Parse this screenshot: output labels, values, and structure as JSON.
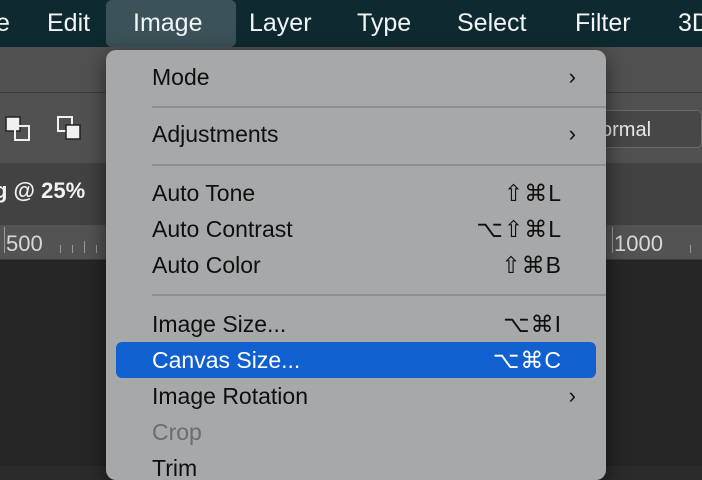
{
  "menubar": {
    "items": [
      "e",
      "Edit",
      "Image",
      "Layer",
      "Type",
      "Select",
      "Filter",
      "3D"
    ],
    "active": "Image"
  },
  "optionsbar": {
    "blend_mode": "ormal"
  },
  "document_tab": {
    "title": "g @ 25%"
  },
  "ruler": {
    "labels": [
      "500",
      "1000"
    ]
  },
  "image_menu": {
    "mode": {
      "label": "Mode"
    },
    "adjustments": {
      "label": "Adjustments"
    },
    "auto_tone": {
      "label": "Auto Tone",
      "shortcut": "⇧⌘L"
    },
    "auto_contrast": {
      "label": "Auto Contrast",
      "shortcut": "⌥⇧⌘L"
    },
    "auto_color": {
      "label": "Auto Color",
      "shortcut": "⇧⌘B"
    },
    "image_size": {
      "label": "Image Size...",
      "shortcut": "⌥⌘I"
    },
    "canvas_size": {
      "label": "Canvas Size...",
      "shortcut": "⌥⌘C"
    },
    "image_rotation": {
      "label": "Image Rotation"
    },
    "crop": {
      "label": "Crop"
    },
    "trim": {
      "label": "Trim"
    },
    "submenu_arrow": "›"
  },
  "colors": {
    "menubar_bg": "#0e2a30",
    "menu_bg": "#a6a8aa",
    "highlight": "#1060d0"
  }
}
